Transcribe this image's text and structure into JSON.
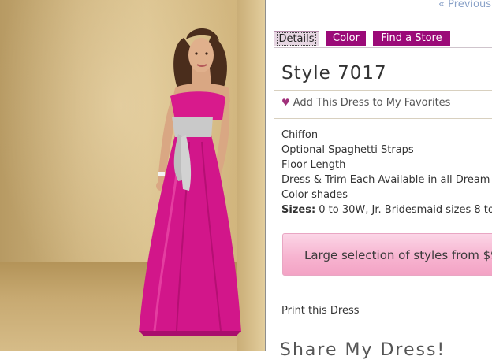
{
  "nav": {
    "previous_label": "« Previous"
  },
  "tabs": [
    {
      "label": "Details",
      "active": true
    },
    {
      "label": "Color",
      "active": false
    },
    {
      "label": "Find a Store",
      "active": false
    }
  ],
  "product": {
    "style_title": "Style 7017",
    "favorites_label": "Add This Dress to My Favorites",
    "details": [
      "Chiffon",
      "Optional Spaghetti Straps",
      "Floor Length",
      "Dress & Trim Each Available in all Dream",
      "Color shades"
    ],
    "sizes_label": "Sizes:",
    "sizes_value": " 0 to 30W, Jr. Bridesmaid sizes 8 to"
  },
  "banner": {
    "text": "Large selection of styles from $9"
  },
  "links": {
    "print": "Print this Dress"
  },
  "share": {
    "heading": "Share My Dress!"
  },
  "colors": {
    "accent": "#9b0a78",
    "dress": "#d81a8c",
    "sash": "#c9c9c9",
    "banner": "#f7b4d0"
  },
  "icons": {
    "favorite": "heart-icon",
    "previous": "double-chevron-left-icon"
  }
}
